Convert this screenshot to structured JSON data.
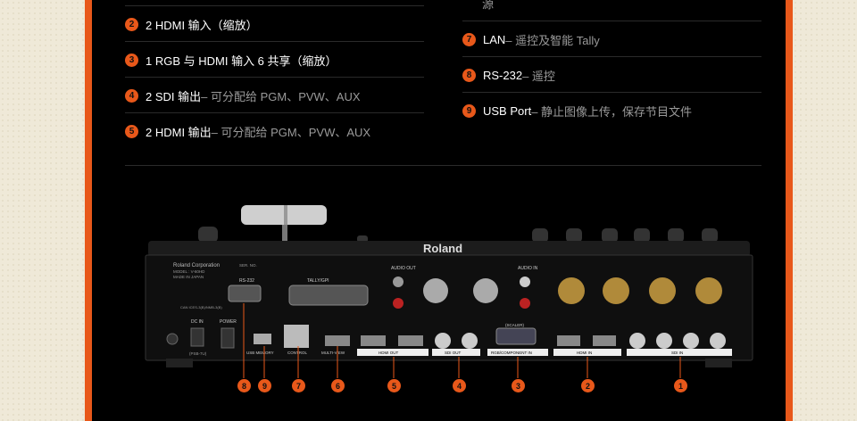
{
  "features_left": [
    {
      "num": "2",
      "title": "2 HDMI 输入（缩放）",
      "desc": ""
    },
    {
      "num": "3",
      "title": "1 RGB 与 HDMI 输入 6 共享（缩放）",
      "desc": ""
    },
    {
      "num": "4",
      "title": "2 SDI 输出",
      "desc": " – 可分配给 PGM、PVW、AUX"
    },
    {
      "num": "5",
      "title": "2 HDMI 输出",
      "desc": " – 可分配给 PGM、PVW、AUX"
    }
  ],
  "features_right": {
    "stub": "源",
    "items": [
      {
        "num": "7",
        "title": "LAN",
        "desc": " – 遥控及智能 Tally"
      },
      {
        "num": "8",
        "title": "RS-232",
        "desc": " – 遥控"
      },
      {
        "num": "9",
        "title": "USB Port",
        "desc": " – 静止图像上传，保存节目文件"
      }
    ]
  },
  "device": {
    "brand": "Roland",
    "corp": "Roland Corporation",
    "model": "MODEL : V-60HD",
    "made": "MADE IN JAPAN",
    "ser": "SER. NO.",
    "ports": {
      "rs232": "RS-232",
      "tally": "TALLY/GPI",
      "audio_out": "AUDIO OUT",
      "audio_in": "AUDIO IN",
      "dc_in": "DC IN",
      "power": "POWER",
      "psb": "(PSB-7U)",
      "usb": "USB MEMORY",
      "control": "CONTROL",
      "multiview": "MULTI-VIEW",
      "hdmi_out": "HDMI OUT",
      "sdi_out": "SDI OUT",
      "rgb_in": "RGB/COMPONENT IN",
      "hdmi_in": "HDMI IN",
      "sdi_in": "SDI IN",
      "scaler": "(SCALER)",
      "can": "CAN ICES-3(B)/NMB-3(B)"
    },
    "callouts": [
      "8",
      "9",
      "7",
      "6",
      "5",
      "4",
      "3",
      "2",
      "1"
    ]
  }
}
